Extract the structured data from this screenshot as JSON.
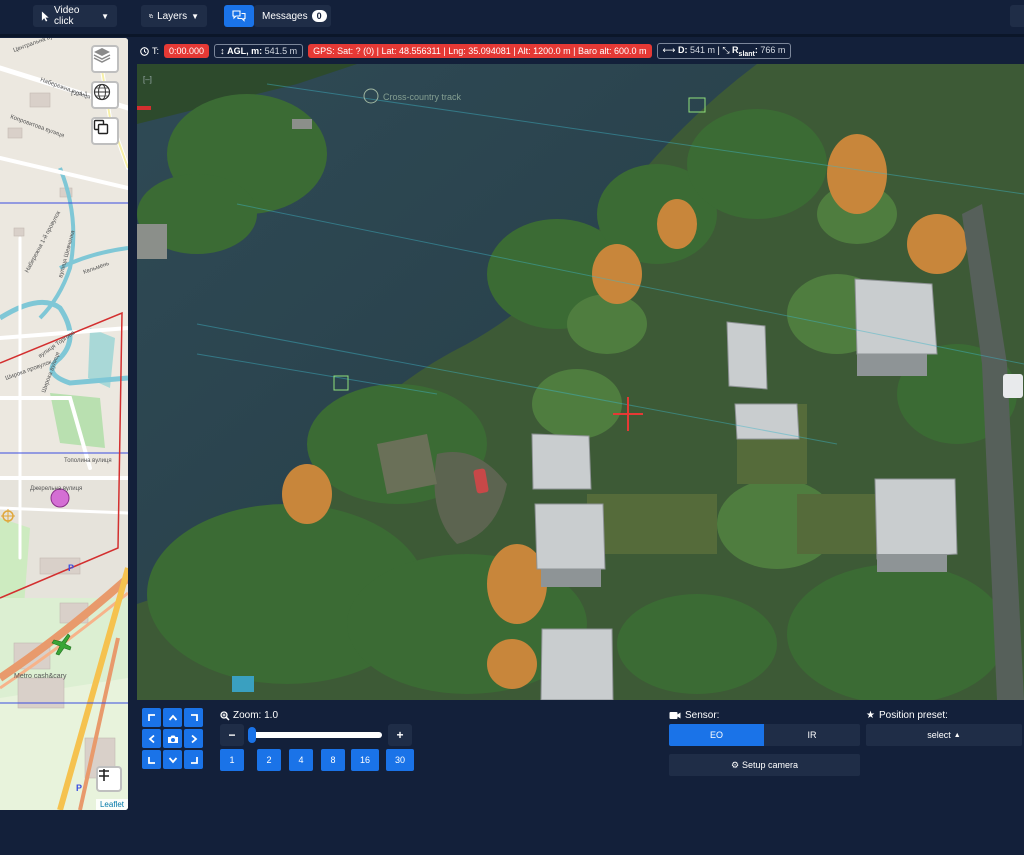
{
  "topbar": {
    "video_click_label": "Video click",
    "layers_label": "Layers",
    "messages_label": "Messages",
    "messages_count": "0"
  },
  "map": {
    "streets": [
      "Центральна вулиця",
      "Т-04-1",
      "Набережна вулиця",
      "Копровитова вулиця",
      "Набережна 1-й провулок",
      "вулиця Шевченка",
      "Кельмень",
      "вулиця Торгова",
      "Широка вулиця",
      "Широка провулок",
      "Тополина вулиця",
      "Джерельна вулиця"
    ],
    "poi_label": "Metro cash&cary",
    "attribution": "Leaflet"
  },
  "telemetry": {
    "time_label": "T:",
    "time_value": "0:00.000",
    "agl_label": "AGL, m:",
    "agl_value": "541.5 m",
    "gps_text": "GPS: Sat: ? (0) | Lat: 48.556311 | Lng: 35.094081 | Alt: 1200.0 m | Baro alt: 600.0 m",
    "distance_label": "D:",
    "distance_value": "541 m",
    "rslant_label": "R",
    "rslant_sub": "slant",
    "rslant_value": "766 m"
  },
  "video": {
    "overlay_label": "Cross-country track"
  },
  "zoom": {
    "label": "Zoom: 1.0",
    "level": 1.0,
    "presets": [
      "1",
      "2",
      "4",
      "8",
      "16",
      "30"
    ]
  },
  "sensor": {
    "label": "Sensor:",
    "options": [
      "EO",
      "IR"
    ],
    "selected": "EO",
    "setup_label": "Setup camera"
  },
  "position_preset": {
    "label": "Position preset:",
    "select_label": "select"
  },
  "colors": {
    "accent": "#1a73e8",
    "alert": "#e53935",
    "background": "#13203a",
    "panel": "#1f2d47"
  }
}
